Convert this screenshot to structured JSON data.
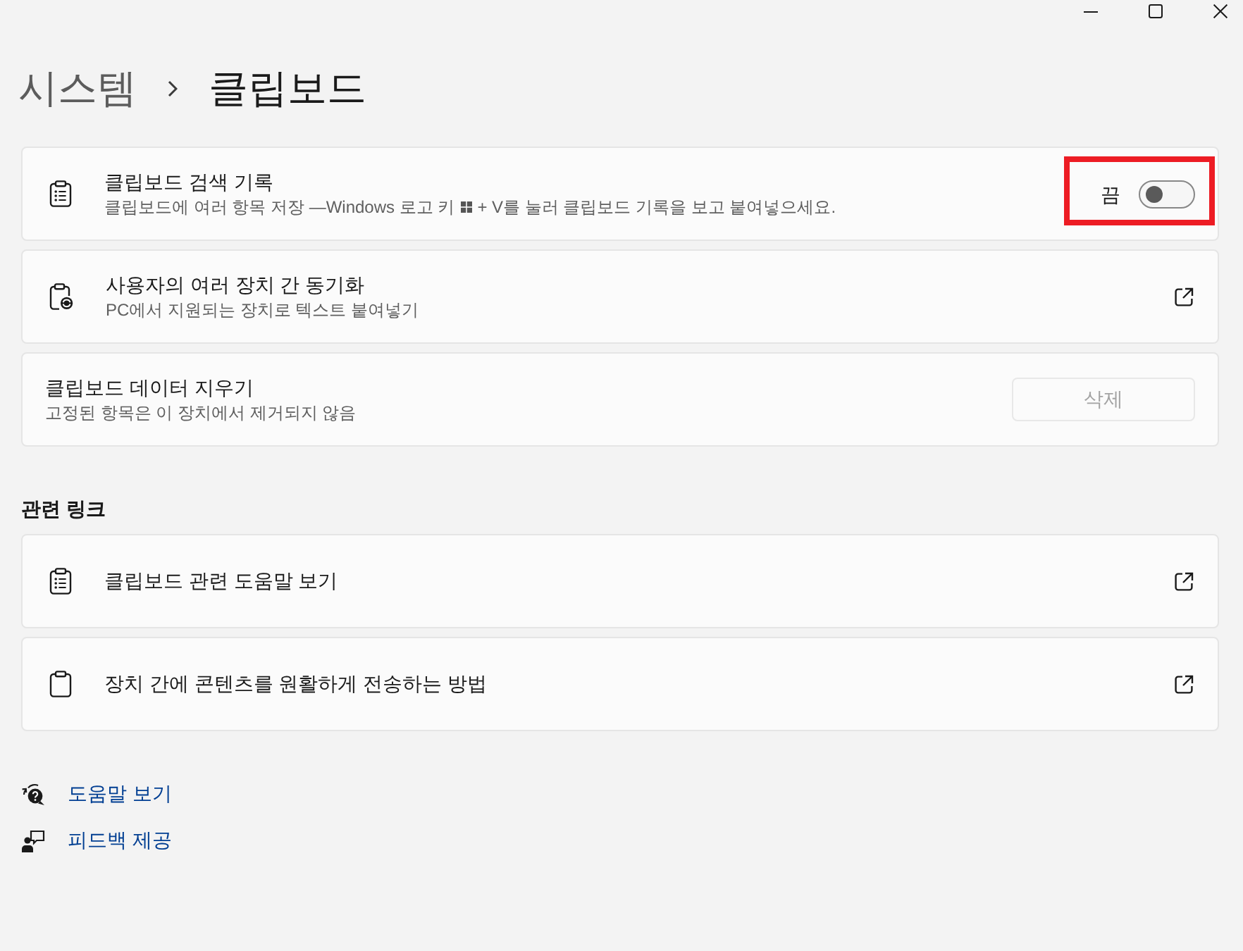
{
  "breadcrumb": [
    {
      "label": "시스템",
      "current": false
    },
    {
      "label": "클립보드",
      "current": true
    }
  ],
  "settings": [
    {
      "kind": "toggle",
      "title": "클립보드 검색 기록",
      "description": [
        "클립보드에 여러 항목 저장 —Windows 로고 키",
        "+ V를 눌러 클립보드 기록을 보고 붙여넣으세요."
      ],
      "state_label": "끔",
      "on": false,
      "highlighted": true
    },
    {
      "kind": "link",
      "title": "사용자의 여러 장치 간 동기화",
      "description": [
        "PC에서 지원되는 장치로 텍스트 붙여넣기"
      ]
    },
    {
      "kind": "button",
      "title": "클립보드 데이터 지우기",
      "description": [
        "고정된 항목은 이 장치에서 제거되지 않음"
      ],
      "button": {
        "label": "삭제",
        "disabled": true
      }
    }
  ],
  "related_links": {
    "heading": "관련 링크",
    "items": [
      {
        "label": "클립보드 관련 도움말 보기"
      },
      {
        "label": "장치 간에 콘텐츠를 원활하게 전송하는 방법"
      }
    ]
  },
  "footer_links": [
    {
      "label": "도움말 보기"
    },
    {
      "label": "피드백 제공"
    }
  ]
}
